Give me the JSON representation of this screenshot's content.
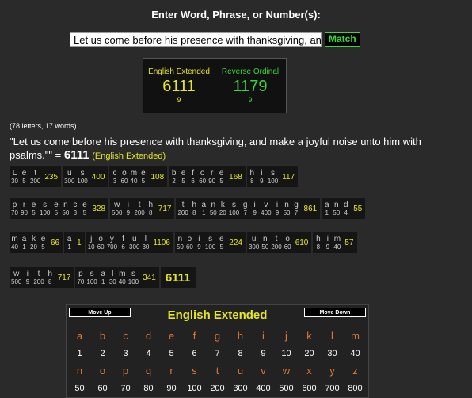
{
  "heading": "Enter Word, Phrase, or Number(s):",
  "search": {
    "value": "Let us come before his presence with thanksgiving, and",
    "button": "Match"
  },
  "results": [
    {
      "name": "English Extended",
      "value": "6111",
      "reduction": "9"
    },
    {
      "name": "Reverse Ordinal",
      "value": "1179",
      "reduction": "9"
    }
  ],
  "stats": "(78 letters, 17 words)",
  "phrase": {
    "text": "\"Let us come before his presence with thanksgiving, and make a joyful noise unto him with psalms.\"\" =",
    "total": "6111",
    "cipher": "(English Extended)"
  },
  "breakdown": [
    [
      {
        "letters": [
          [
            "L",
            "30"
          ],
          [
            "e",
            "5"
          ],
          [
            "t",
            "200"
          ]
        ],
        "total": "235"
      },
      {
        "letters": [
          [
            "u",
            "300"
          ],
          [
            "s",
            "100"
          ]
        ],
        "total": "400"
      },
      {
        "letters": [
          [
            "c",
            "3"
          ],
          [
            "o",
            "60"
          ],
          [
            "m",
            "40"
          ],
          [
            "e",
            "5"
          ]
        ],
        "total": "108"
      },
      {
        "letters": [
          [
            "b",
            "2"
          ],
          [
            "e",
            "5"
          ],
          [
            "f",
            "6"
          ],
          [
            "o",
            "60"
          ],
          [
            "r",
            "90"
          ],
          [
            "e",
            "5"
          ]
        ],
        "total": "168"
      },
      {
        "letters": [
          [
            "h",
            "8"
          ],
          [
            "i",
            "9"
          ],
          [
            "s",
            "100"
          ]
        ],
        "total": "117"
      }
    ],
    [
      {
        "letters": [
          [
            "p",
            "70"
          ],
          [
            "r",
            "90"
          ],
          [
            "e",
            "5"
          ],
          [
            "s",
            "100"
          ],
          [
            "e",
            "5"
          ],
          [
            "n",
            "50"
          ],
          [
            "c",
            "3"
          ],
          [
            "e",
            "5"
          ]
        ],
        "total": "328"
      },
      {
        "letters": [
          [
            "w",
            "500"
          ],
          [
            "i",
            "9"
          ],
          [
            "t",
            "200"
          ],
          [
            "h",
            "8"
          ]
        ],
        "total": "717"
      },
      {
        "letters": [
          [
            "t",
            "200"
          ],
          [
            "h",
            "8"
          ],
          [
            "a",
            "1"
          ],
          [
            "n",
            "50"
          ],
          [
            "k",
            "20"
          ],
          [
            "s",
            "100"
          ],
          [
            "g",
            "7"
          ],
          [
            "i",
            "9"
          ],
          [
            "v",
            "400"
          ],
          [
            "i",
            "9"
          ],
          [
            "n",
            "50"
          ],
          [
            "g",
            "7"
          ]
        ],
        "total": "861"
      },
      {
        "letters": [
          [
            "a",
            "1"
          ],
          [
            "n",
            "50"
          ],
          [
            "d",
            "4"
          ]
        ],
        "total": "55"
      }
    ],
    [
      {
        "letters": [
          [
            "m",
            "40"
          ],
          [
            "a",
            "1"
          ],
          [
            "k",
            "20"
          ],
          [
            "e",
            "5"
          ]
        ],
        "total": "66"
      },
      {
        "letters": [
          [
            "a",
            "1"
          ]
        ],
        "total": "1"
      },
      {
        "letters": [
          [
            "j",
            "10"
          ],
          [
            "o",
            "60"
          ],
          [
            "y",
            "700"
          ],
          [
            "f",
            "6"
          ],
          [
            "u",
            "300"
          ],
          [
            "l",
            "30"
          ]
        ],
        "total": "1106"
      },
      {
        "letters": [
          [
            "n",
            "50"
          ],
          [
            "o",
            "60"
          ],
          [
            "i",
            "9"
          ],
          [
            "s",
            "100"
          ],
          [
            "e",
            "5"
          ]
        ],
        "total": "224"
      },
      {
        "letters": [
          [
            "u",
            "300"
          ],
          [
            "n",
            "50"
          ],
          [
            "t",
            "200"
          ],
          [
            "o",
            "60"
          ]
        ],
        "total": "610"
      },
      {
        "letters": [
          [
            "h",
            "8"
          ],
          [
            "i",
            "9"
          ],
          [
            "m",
            "40"
          ]
        ],
        "total": "57"
      }
    ],
    [
      {
        "letters": [
          [
            "w",
            "500"
          ],
          [
            "i",
            "9"
          ],
          [
            "t",
            "200"
          ],
          [
            "h",
            "8"
          ]
        ],
        "total": "717"
      },
      {
        "letters": [
          [
            "p",
            "70"
          ],
          [
            "s",
            "100"
          ],
          [
            "a",
            "1"
          ],
          [
            "l",
            "30"
          ],
          [
            "m",
            "40"
          ],
          [
            "s",
            "100"
          ]
        ],
        "total": "341"
      }
    ]
  ],
  "final_total": "6111",
  "key": {
    "move_up": "Move Up",
    "move_down": "Move Down",
    "title": "English Extended",
    "rows": [
      {
        "letters": [
          "a",
          "b",
          "c",
          "d",
          "e",
          "f",
          "g",
          "h",
          "i",
          "j",
          "k",
          "l",
          "m"
        ],
        "values": [
          "1",
          "2",
          "3",
          "4",
          "5",
          "6",
          "7",
          "8",
          "9",
          "10",
          "20",
          "30",
          "40"
        ]
      },
      {
        "letters": [
          "n",
          "o",
          "p",
          "q",
          "r",
          "s",
          "t",
          "u",
          "v",
          "w",
          "x",
          "y",
          "z"
        ],
        "values": [
          "50",
          "60",
          "70",
          "80",
          "90",
          "100",
          "200",
          "300",
          "400",
          "500",
          "600",
          "700",
          "800"
        ]
      }
    ]
  },
  "colors": {
    "background": "#2a2a2a",
    "accent_yellow": "#e6e628",
    "accent_green": "#39d839",
    "letter_orange": "#e07830"
  }
}
